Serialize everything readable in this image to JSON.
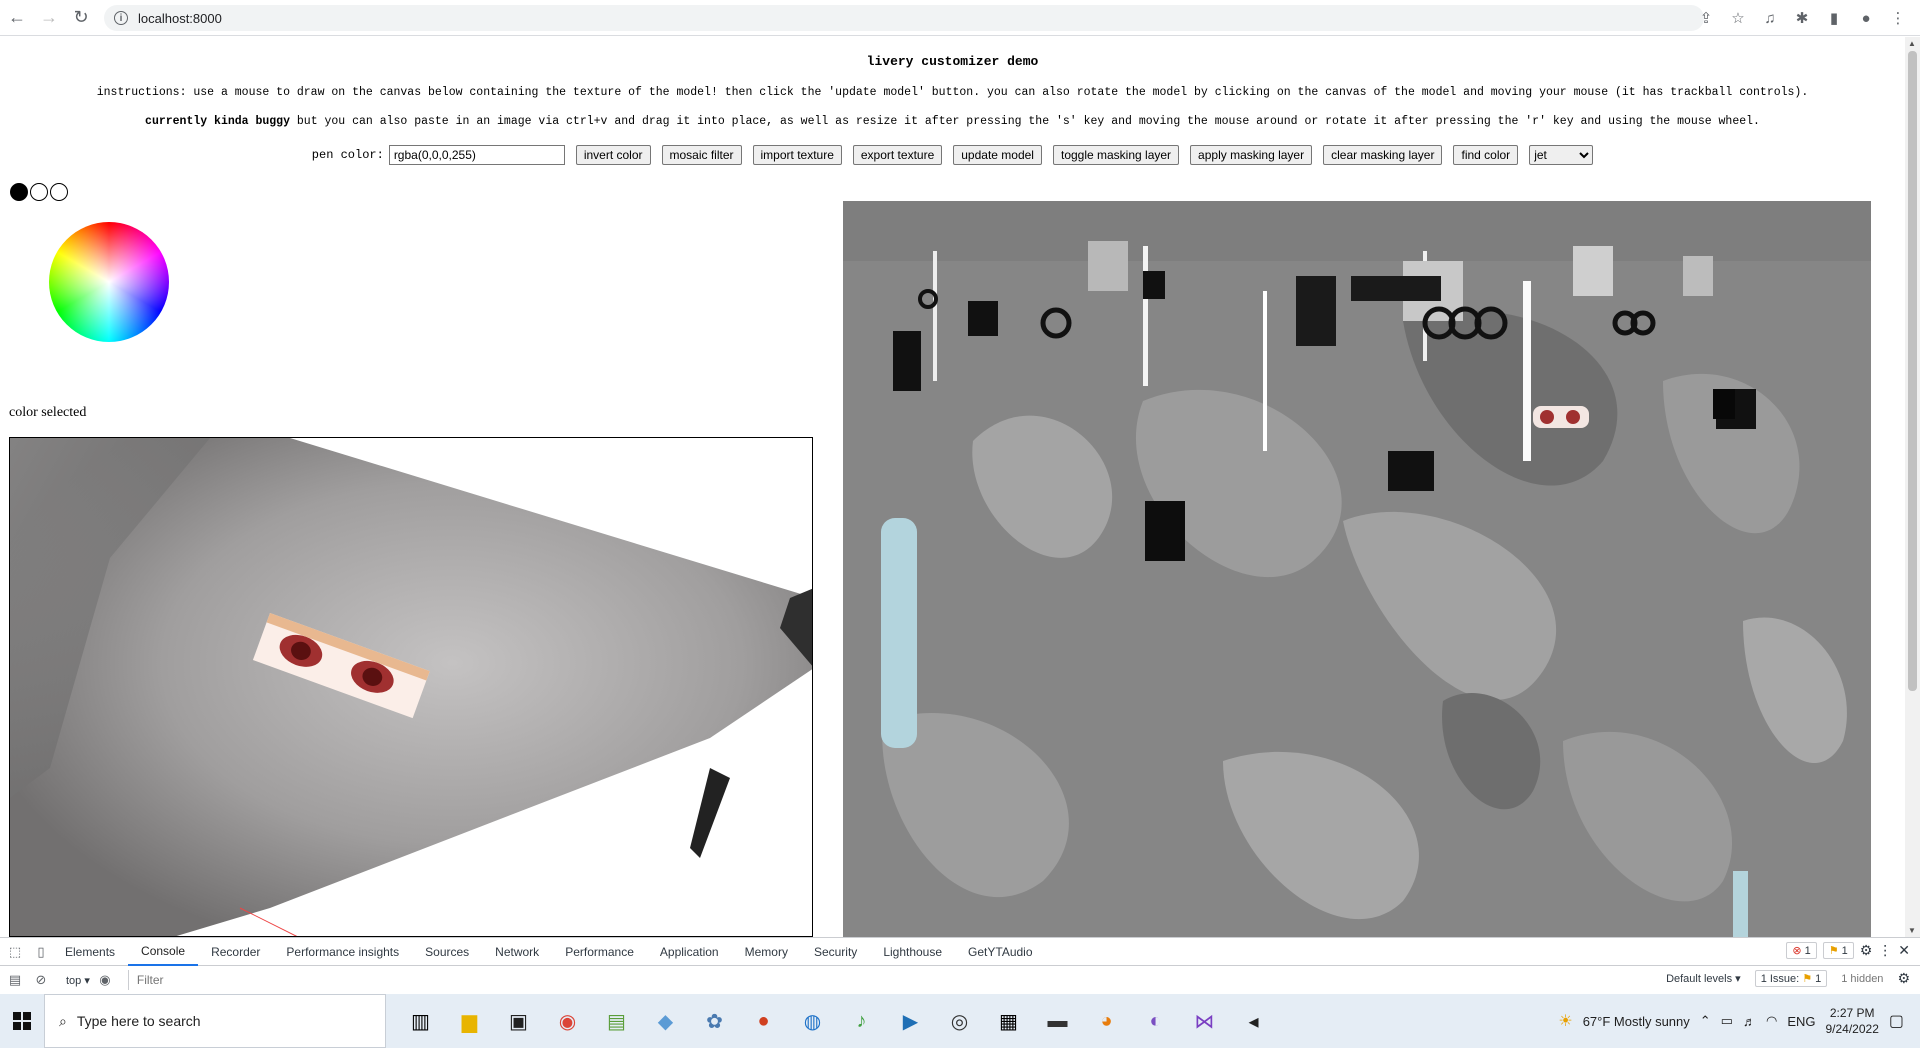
{
  "browser": {
    "url": "localhost:8000"
  },
  "page": {
    "title": "livery customizer demo",
    "instructions_1": "instructions: use a mouse to draw on the canvas below containing the texture of the model! then click the 'update model' button. you can also rotate the model by clicking on the canvas of the model and moving your mouse (it has trackball controls).",
    "instructions_2_bold": "currently kinda buggy",
    "instructions_2_rest": " but you can also paste in an image via ctrl+v and drag it into place, as well as resize it after pressing the 's' key and moving the mouse around or rotate it after pressing the 'r' key and using the mouse wheel.",
    "pen_color_label": "pen color:",
    "pen_color_value": "rgba(0,0,0,255)",
    "buttons": {
      "invert_color": "invert color",
      "mosaic_filter": "mosaic filter",
      "import_texture": "import texture",
      "export_texture": "export texture",
      "update_model": "update model",
      "toggle_masking_layer": "toggle masking layer",
      "apply_masking_layer": "apply masking layer",
      "clear_masking_layer": "clear masking layer",
      "find_color": "find color"
    },
    "colormap_selected": "jet",
    "color_selected_label": "color selected"
  },
  "devtools": {
    "tabs": [
      "Elements",
      "Console",
      "Recorder",
      "Performance insights",
      "Sources",
      "Network",
      "Performance",
      "Application",
      "Memory",
      "Security",
      "Lighthouse",
      "GetYTAudio"
    ],
    "active_tab": "Console",
    "errors": "1",
    "warnings": "1",
    "context": "top",
    "filter_placeholder": "Filter",
    "levels": "Default levels",
    "issues": "1 Issue:",
    "issues_count": "1",
    "hidden": "1 hidden"
  },
  "taskbar": {
    "search_placeholder": "Type here to search",
    "weather": "67°F  Mostly sunny",
    "lang": "ENG",
    "time": "2:27 PM",
    "date": "9/24/2022"
  }
}
